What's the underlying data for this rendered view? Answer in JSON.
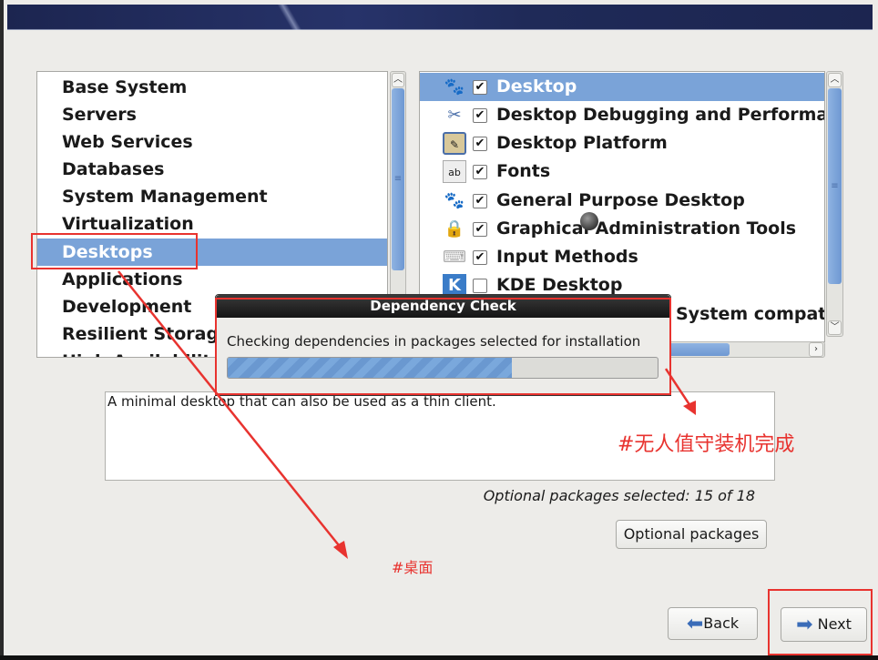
{
  "categories": {
    "items": [
      "Base System",
      "Servers",
      "Web Services",
      "Databases",
      "System Management",
      "Virtualization",
      "Desktops",
      "Applications",
      "Development",
      "Resilient Storage",
      "High Availability"
    ],
    "selected": "Desktops"
  },
  "groups": {
    "items": [
      {
        "label": "Desktop",
        "checked": true,
        "icon": "gnome-foot-icon",
        "selected": true
      },
      {
        "label": "Desktop Debugging and Performance",
        "checked": true,
        "icon": "tools-icon"
      },
      {
        "label": "Desktop Platform",
        "checked": true,
        "icon": "desktop-platform-icon"
      },
      {
        "label": "Fonts",
        "checked": true,
        "icon": "fonts-icon"
      },
      {
        "label": "General Purpose Desktop",
        "checked": true,
        "icon": "gnome-foot-icon"
      },
      {
        "label": "Graphical Administration Tools",
        "checked": true,
        "icon": "monitor-lock-icon"
      },
      {
        "label": "Input Methods",
        "checked": true,
        "icon": "keyboard-icon"
      },
      {
        "label": "KDE Desktop",
        "checked": false,
        "icon": "kde-icon"
      },
      {
        "label": "System compat",
        "checked": null,
        "icon": ""
      }
    ]
  },
  "dialog": {
    "title": "Dependency Check",
    "message": "Checking dependencies in packages selected for installation",
    "progress_percent": 66
  },
  "description": "A minimal desktop that can also be used as a thin client.",
  "optional_count": "Optional packages selected: 15 of 18",
  "buttons": {
    "optional": "Optional packages",
    "back": "Back",
    "next": "Next"
  },
  "annotations": {
    "done": "#无人值守装机完成",
    "desktop": "#桌面",
    "color": "#e8332f"
  }
}
